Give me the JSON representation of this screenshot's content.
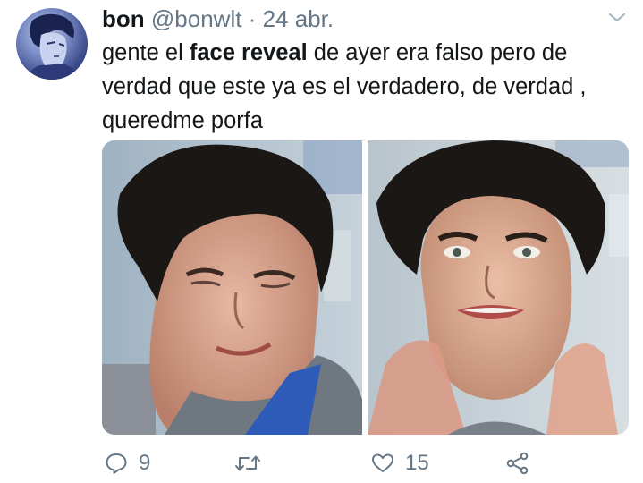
{
  "tweet": {
    "display_name": "bon",
    "handle": "@bonwlt",
    "separator": "·",
    "date": "24 abr.",
    "text_before": "gente el ",
    "text_bold": "face reveal",
    "text_after": " de ayer era falso pero de verdad que este ya es el verdadero, de verdad , queredme porfa",
    "images": [
      "left-photo",
      "right-photo"
    ]
  },
  "actions": {
    "reply_count": "9",
    "retweet_count": "",
    "like_count": "15"
  },
  "icons": {
    "caret": "chevron-down-icon",
    "reply": "reply-icon",
    "retweet": "retweet-icon",
    "like": "heart-icon",
    "share": "share-icon"
  },
  "colors": {
    "text": "#14171a",
    "muted": "#657786"
  }
}
